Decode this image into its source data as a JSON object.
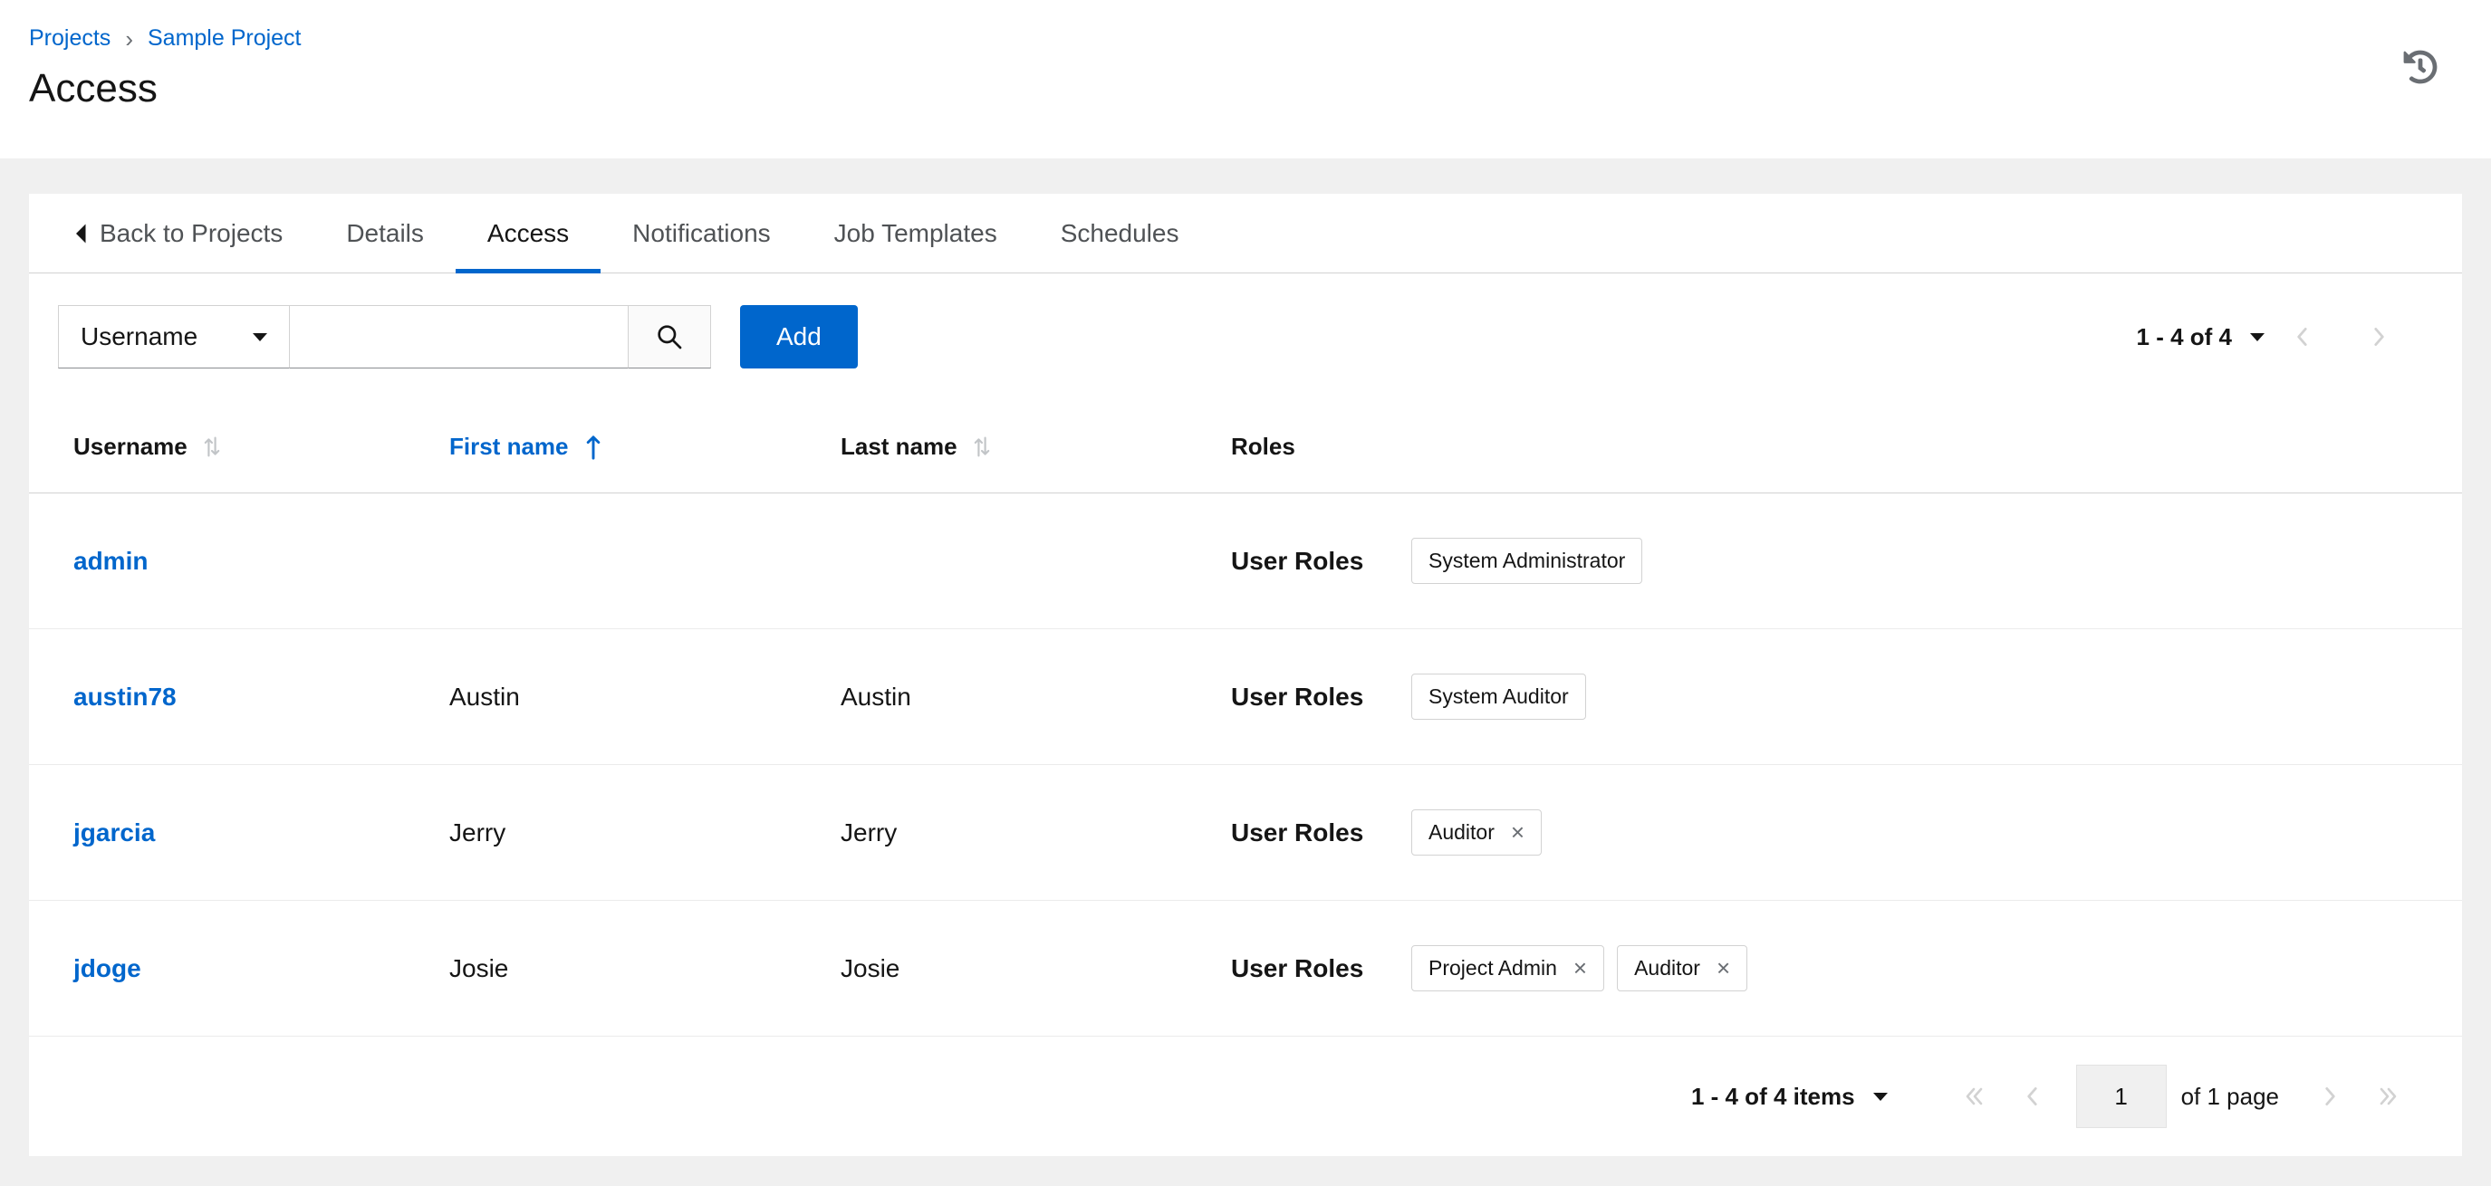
{
  "colors": {
    "primary": "#0066cc",
    "link": "#0066cc",
    "text": "#151515",
    "muted": "#6a6e73",
    "border": "#d2d2d2",
    "disabled_icon": "#d2d2d2",
    "page_background": "#f0f0f0",
    "card_background": "#ffffff"
  },
  "glyphs": {
    "close": "×",
    "breadcrumb_separator": "›"
  },
  "icons": {
    "history": "history-icon",
    "search": "search-icon",
    "caret_down": "caret-down-icon",
    "caret_left": "caret-left-icon",
    "sort": "sort-both-icon",
    "sort_asc": "arrow-up-icon",
    "chip_close": "close-icon",
    "first": "double-angle-left-icon",
    "prev": "angle-left-icon",
    "next": "angle-right-icon",
    "last": "double-angle-right-icon"
  },
  "breadcrumb": {
    "projects": "Projects",
    "current": "Sample Project"
  },
  "page": {
    "title": "Access"
  },
  "tabs": {
    "back_label": "Back to Projects",
    "items": [
      {
        "label": "Details",
        "active": false
      },
      {
        "label": "Access",
        "active": true
      },
      {
        "label": "Notifications",
        "active": false
      },
      {
        "label": "Job Templates",
        "active": false
      },
      {
        "label": "Schedules",
        "active": false
      }
    ]
  },
  "toolbar": {
    "filter_selected": "Username",
    "search_value": "",
    "add_label": "Add",
    "pagination_summary": "1 - 4 of 4"
  },
  "table": {
    "columns": [
      {
        "label": "Username",
        "sortable": true,
        "sorted": false
      },
      {
        "label": "First name",
        "sortable": true,
        "sorted": "asc"
      },
      {
        "label": "Last name",
        "sortable": true,
        "sorted": false
      },
      {
        "label": "Roles",
        "sortable": false
      }
    ],
    "roles_label": "User Roles",
    "rows": [
      {
        "username": "admin",
        "first_name": "",
        "last_name": "",
        "chips": [
          {
            "label": "System Administrator",
            "removable": false
          }
        ]
      },
      {
        "username": "austin78",
        "first_name": "Austin",
        "last_name": "Austin",
        "chips": [
          {
            "label": "System Auditor",
            "removable": false
          }
        ]
      },
      {
        "username": "jgarcia",
        "first_name": "Jerry",
        "last_name": "Jerry",
        "chips": [
          {
            "label": "Auditor",
            "removable": true
          }
        ]
      },
      {
        "username": "jdoge",
        "first_name": "Josie",
        "last_name": "Josie",
        "chips": [
          {
            "label": "Project Admin",
            "removable": true
          },
          {
            "label": "Auditor",
            "removable": true
          }
        ]
      }
    ]
  },
  "footer": {
    "items_summary": "1 - 4 of 4 items",
    "current_page": "1",
    "page_label": "of 1 page"
  }
}
